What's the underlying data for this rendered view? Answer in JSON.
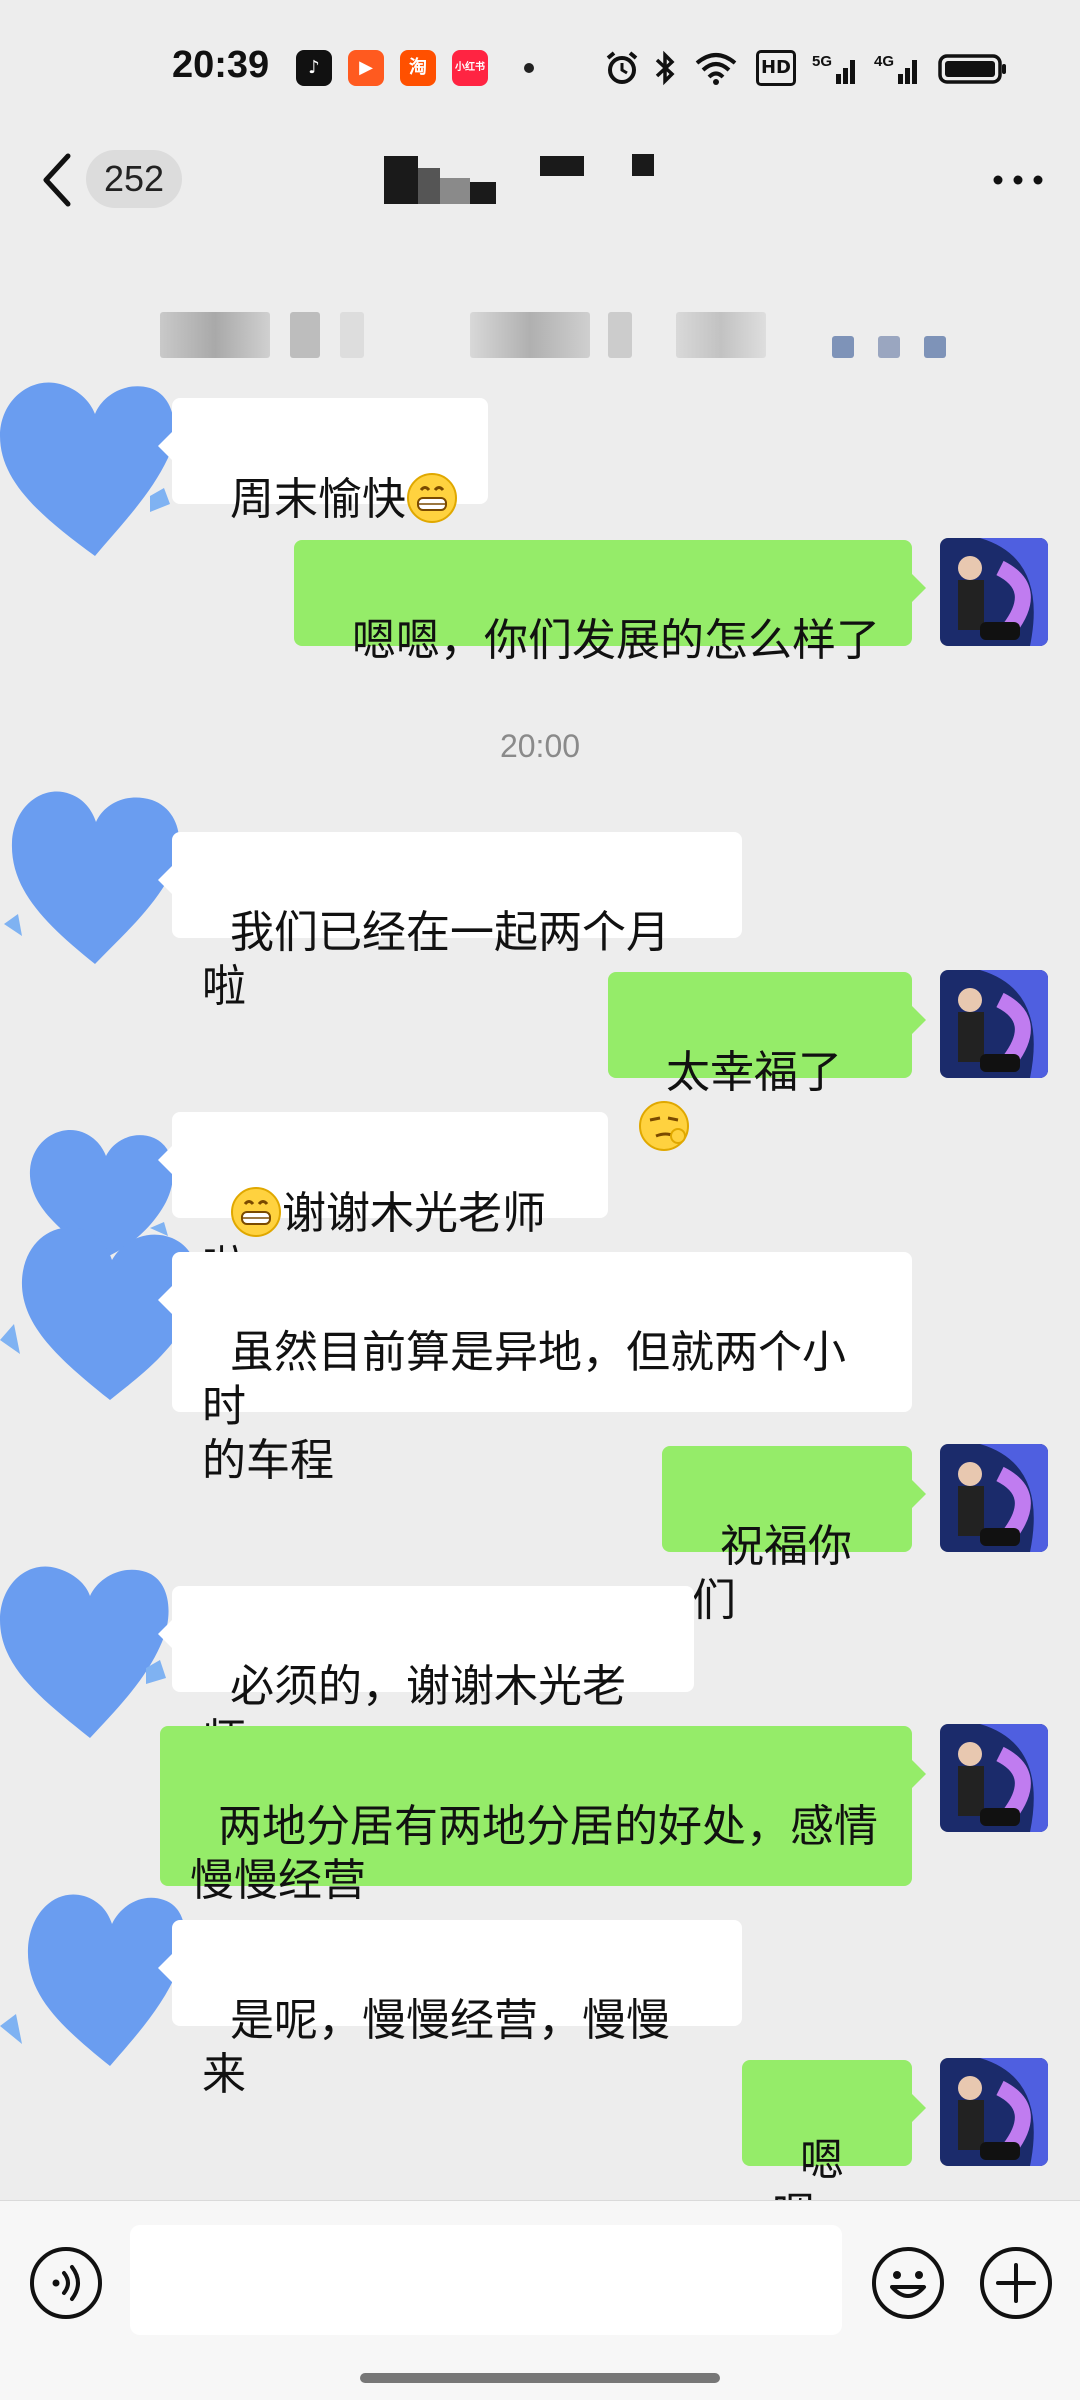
{
  "status_bar": {
    "time": "20:39",
    "apps": [
      {
        "name": "tiktok-icon",
        "color": "#111111",
        "glyph": "♪"
      },
      {
        "name": "video-app-icon",
        "color": "#ff5a1f",
        "glyph": "▶"
      },
      {
        "name": "taobao-icon",
        "color": "#ff5000",
        "glyph": "淘"
      },
      {
        "name": "xiaohongshu-icon",
        "color": "#ff2442",
        "glyph": "小红书"
      }
    ],
    "network": "HD",
    "network_labels": [
      "5G",
      "4G"
    ]
  },
  "header": {
    "unread_count": "252",
    "contact_name": "",
    "colors": {
      "mask": "#1a1a1a"
    }
  },
  "messages": [
    {
      "side": "left",
      "text": "周末愉快",
      "emoji_after": "grin-emoji"
    },
    {
      "side": "right",
      "text": "嗯嗯，你们发展的怎么样了"
    },
    {
      "side": "time",
      "text": "20:00"
    },
    {
      "side": "left",
      "text": "我们已经在一起两个月啦"
    },
    {
      "side": "right",
      "text": "太幸福了",
      "emoji_after": "smirk-emoji"
    },
    {
      "side": "left",
      "text": "谢谢木光老师啦",
      "emoji_before": "grin-emoji"
    },
    {
      "side": "left",
      "text": "虽然目前算是异地，但就两个小时\n的车程"
    },
    {
      "side": "right",
      "text": "祝福你们"
    },
    {
      "side": "left",
      "text": "必须的，谢谢木光老师"
    },
    {
      "side": "right",
      "text": "两地分居有两地分居的好处，感情\n慢慢经营"
    },
    {
      "side": "left",
      "text": "是呢，慢慢经营，慢慢来"
    },
    {
      "side": "right",
      "text": "嗯嗯，"
    }
  ],
  "colors": {
    "background": "#ededed",
    "bubble_right": "#95ec69",
    "bubble_left": "#ffffff",
    "heart_avatar": "#6a9df0"
  },
  "input_bar": {
    "value": ""
  }
}
